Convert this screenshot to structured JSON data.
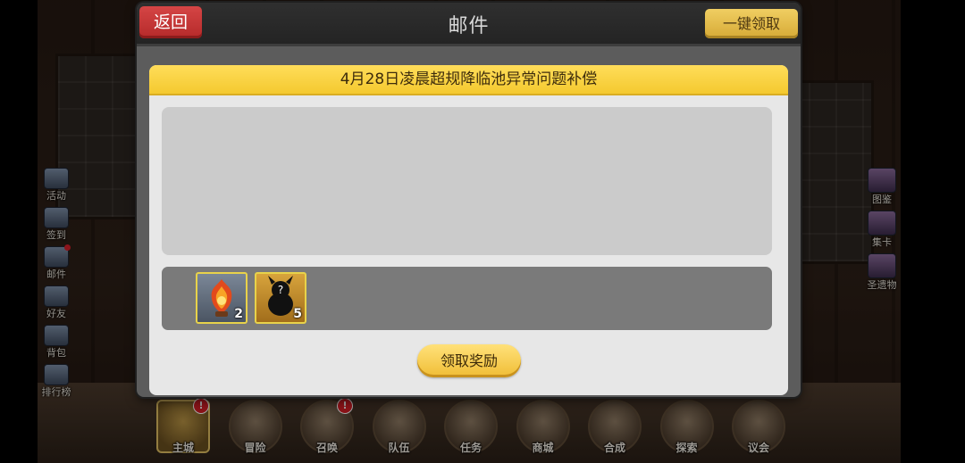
{
  "left_menu": [
    {
      "label": "活动",
      "icon": "event-icon",
      "alert": false
    },
    {
      "label": "签到",
      "icon": "checkin-icon",
      "alert": false
    },
    {
      "label": "邮件",
      "icon": "mail-icon",
      "alert": true
    },
    {
      "label": "好友",
      "icon": "friends-icon",
      "alert": false
    },
    {
      "label": "背包",
      "icon": "backpack-icon",
      "alert": false
    },
    {
      "label": "排行榜",
      "icon": "ranking-icon",
      "alert": false
    }
  ],
  "right_menu": [
    {
      "label": "图鉴",
      "icon": "codex-icon"
    },
    {
      "label": "集卡",
      "icon": "card-collection-icon"
    },
    {
      "label": "圣遗物",
      "icon": "relic-icon"
    }
  ],
  "bottom_nav": [
    {
      "label": "主城",
      "icon": "main-city-icon",
      "alert": "!",
      "active": true
    },
    {
      "label": "冒险",
      "icon": "adventure-icon",
      "alert": "",
      "active": false
    },
    {
      "label": "召唤",
      "icon": "summon-icon",
      "alert": "!",
      "active": false
    },
    {
      "label": "队伍",
      "icon": "team-icon",
      "alert": "",
      "active": false
    },
    {
      "label": "任务",
      "icon": "quest-icon",
      "alert": "",
      "active": false
    },
    {
      "label": "商城",
      "icon": "shop-icon",
      "alert": "",
      "active": false
    },
    {
      "label": "合成",
      "icon": "synthesis-icon",
      "alert": "",
      "active": false
    },
    {
      "label": "探索",
      "icon": "explore-icon",
      "alert": "",
      "active": false
    },
    {
      "label": "议会",
      "icon": "council-icon",
      "alert": "",
      "active": false
    }
  ],
  "mail": {
    "back_label": "返回",
    "title": "邮件",
    "claim_all_label": "一键领取",
    "subject": "4月28日凌晨超规降临池异常问题补偿",
    "body": "",
    "rewards": [
      {
        "icon": "flame-crystal-icon",
        "count": "2"
      },
      {
        "icon": "mystery-character-icon",
        "count": "5"
      }
    ],
    "claim_label": "领取奖励"
  },
  "colors": {
    "accent_yellow": "#f4c92f",
    "back_red": "#d54545",
    "alert_red": "#d41e26"
  }
}
